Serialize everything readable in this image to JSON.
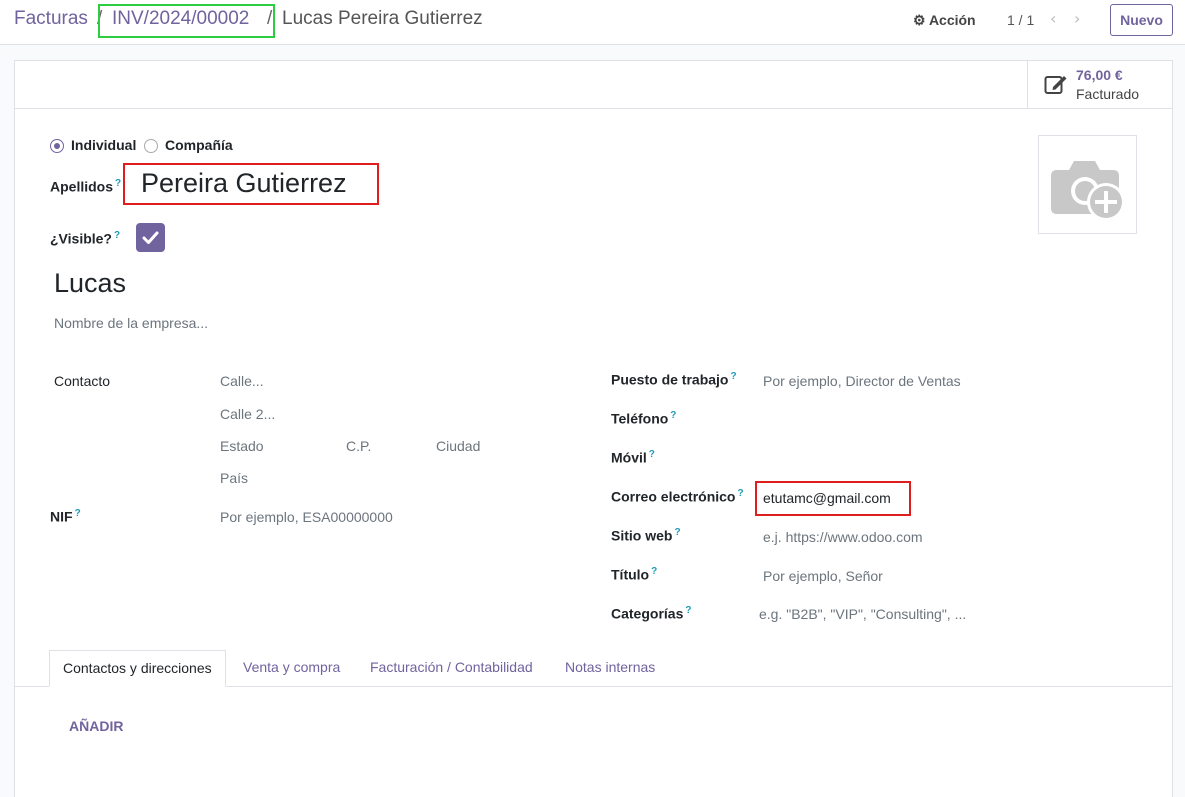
{
  "breadcrumb": {
    "root": "Facturas",
    "invoice": "INV/2024/00002",
    "current": "Lucas Pereira Gutierrez",
    "separator": "/"
  },
  "toolbar": {
    "action_label": "Acción",
    "pager": "1 / 1",
    "new_label": "Nuevo"
  },
  "stat_button": {
    "value": "76,00 €",
    "label": "Facturado"
  },
  "company_type": {
    "options": [
      "Individual",
      "Compañía"
    ],
    "selected": "Individual"
  },
  "form": {
    "apellidos_label": "Apellidos",
    "apellidos_value": "Pereira Gutierrez",
    "visible_label": "¿Visible?",
    "visible_checked": true,
    "name": "Lucas",
    "company_placeholder": "Nombre de la empresa...",
    "help_mark": "?"
  },
  "address": {
    "label": "Contacto",
    "street_placeholder": "Calle...",
    "street2_placeholder": "Calle 2...",
    "state_placeholder": "Estado",
    "zip_placeholder": "C.P.",
    "city_placeholder": "Ciudad",
    "country_placeholder": "País"
  },
  "vat": {
    "label": "NIF",
    "placeholder": "Por ejemplo, ESA00000000"
  },
  "right_fields": {
    "job_label": "Puesto de trabajo",
    "job_placeholder": "Por ejemplo, Director de Ventas",
    "phone_label": "Teléfono",
    "mobile_label": "Móvil",
    "email_label": "Correo electrónico",
    "email_value": "etutamc@gmail.com",
    "website_label": "Sitio web",
    "website_placeholder": "e.j. https://www.odoo.com",
    "title_label": "Título",
    "title_placeholder": "Por ejemplo, Señor",
    "tags_label": "Categorías",
    "tags_placeholder": "e.g. \"B2B\", \"VIP\", \"Consulting\", ..."
  },
  "tabs": [
    "Contactos y direcciones",
    "Venta y compra",
    "Facturación / Contabilidad",
    "Notas internas"
  ],
  "add_label": "AÑADIR",
  "colors": {
    "accent": "#71639e",
    "help": "#1f9bb5",
    "highlight_green": "#2ecc40",
    "highlight_red": "#e01e1e"
  }
}
